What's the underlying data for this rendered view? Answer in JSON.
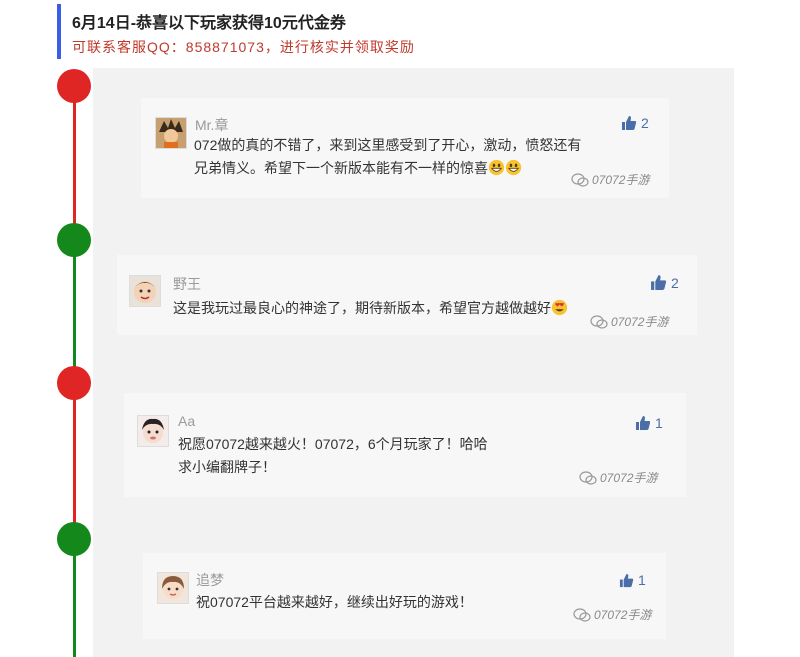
{
  "header": {
    "title": "6月14日-恭喜以下玩家获得10元代金券",
    "subtitle": "可联系客服QQ：858871073，进行核实并领取奖励",
    "accent_color": "#3b5ee6",
    "subtitle_color": "#c0392b"
  },
  "timeline": {
    "dot_colors": [
      "#e02525",
      "#14881a",
      "#e02525",
      "#14881a"
    ]
  },
  "comments": [
    {
      "username": "Mr.章",
      "likes": "2",
      "lines": [
        "072做的真的不错了，来到这里感受到了开心，激动，愤怒还有",
        "兄弟情义。希望下一个新版本能有不一样的惊喜"
      ],
      "emojis": [
        "grinning-face-emoji",
        "grinning-face-emoji"
      ],
      "watermark": "07072手游"
    },
    {
      "username": "野王",
      "likes": "2",
      "lines": [
        "这是我玩过最良心的神途了，期待新版本，希望官方越做越好"
      ],
      "emojis": [
        "heart-eyes-emoji"
      ],
      "watermark": "07072手游"
    },
    {
      "username": "Aa",
      "likes": "1",
      "lines": [
        "祝愿07072越来越火！07072，6个月玩家了！哈哈",
        "求小编翻牌子！"
      ],
      "emojis": [],
      "watermark": "07072手游"
    },
    {
      "username": "追梦",
      "likes": "1",
      "lines": [
        "祝07072平台越来越好，继续出好玩的游戏！"
      ],
      "emojis": [],
      "watermark": "07072手游"
    }
  ]
}
